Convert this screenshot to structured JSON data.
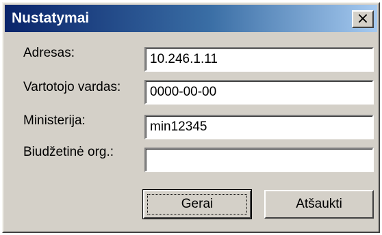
{
  "window": {
    "title": "Nustatymai",
    "close_glyph": "×"
  },
  "form": {
    "address": {
      "label": "Adresas:",
      "value": "10.246.1.11"
    },
    "username": {
      "label": "Vartotojo vardas:",
      "value": "0000-00-00"
    },
    "ministry": {
      "label": "Ministerija:",
      "value": "min12345"
    },
    "budget_org": {
      "label": "Biudžetinė org.:",
      "value": ""
    }
  },
  "buttons": {
    "ok_label": "Gerai",
    "cancel_label": "Atšaukti"
  },
  "colors": {
    "face": "#d4d0c8",
    "title_start": "#0a246a",
    "title_end": "#a6caf0"
  },
  "icons": {
    "close": "close-icon"
  }
}
